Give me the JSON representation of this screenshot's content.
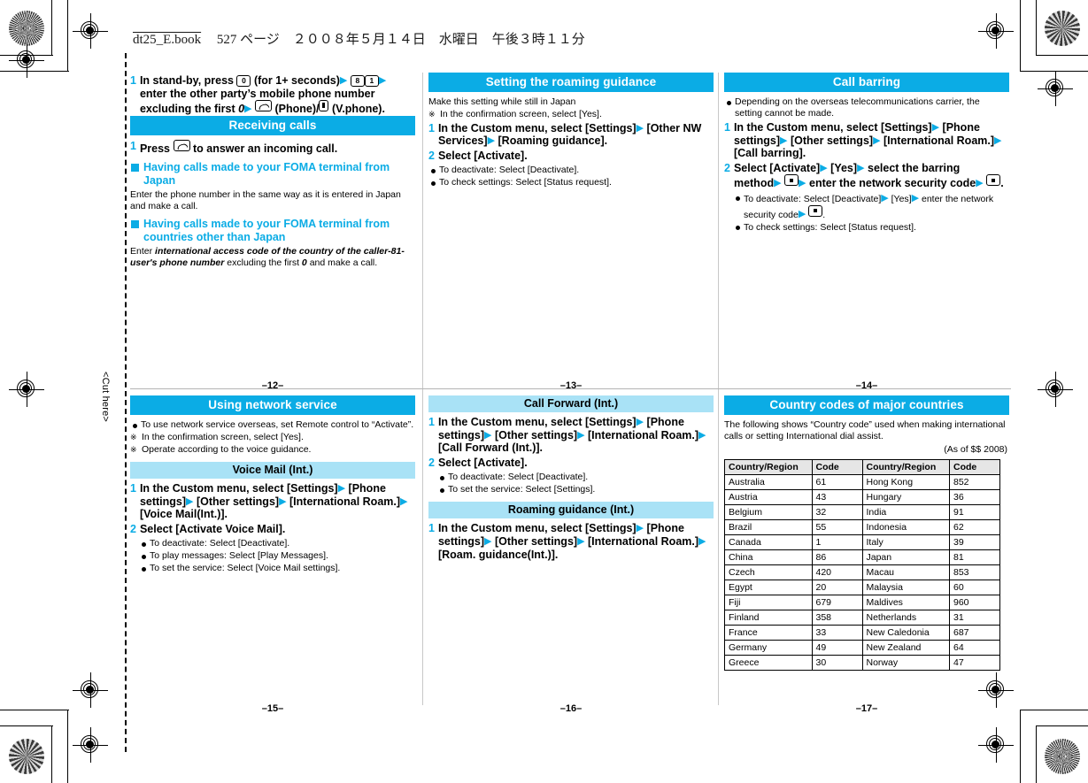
{
  "meta": {
    "book_line": "dt25_E.book",
    "book_line_rest": "527 ページ　２００８年５月１４日　水曜日　午後３時１１分",
    "cut_here": "<Cut here>",
    "accent_color": "#0BACE5",
    "subheader_color": "#A9E2F6"
  },
  "pages": {
    "p12": "–12–",
    "p13": "–13–",
    "p14": "–14–",
    "p15": "–15–",
    "p16": "–16–",
    "p17": "–17–"
  },
  "col1": {
    "step1": {
      "num": "1",
      "a": "In stand-by, press",
      "key0": "0",
      "b": "(for 1+ seconds)",
      "key8": "8",
      "key1": "1",
      "c": "enter the other party’s mobile phone number excluding the first",
      "zero": "0",
      "d": "(Phone)/",
      "e": "(V.phone)."
    },
    "receiving_header": "Receiving calls",
    "receiving_step": {
      "num": "1",
      "a": "Press",
      "b": "to answer an incoming call."
    },
    "sub1_title": "Having calls made to your FOMA terminal from Japan",
    "sub1_text": "Enter the phone number in the same way as it is entered in Japan and make a call.",
    "sub2_title": "Having calls made to your FOMA terminal from countries other than Japan",
    "sub2_pre": "Enter",
    "sub2_em": "international access code of the country of the caller-81-user's phone number",
    "sub2_mid": "excluding the first",
    "sub2_zero": "0",
    "sub2_post": "and make a call."
  },
  "col2": {
    "header": "Setting the roaming guidance",
    "lead": "Make this setting while still in Japan",
    "note": "In the confirmation screen, select [Yes].",
    "step1": {
      "num": "1",
      "a": "In the Custom menu, select [Settings]",
      "b": "[Other NW Services]",
      "c": "[Roaming guidance]."
    },
    "step2": {
      "num": "2",
      "a": "Select [Activate]."
    },
    "bullets": [
      "To deactivate: Select [Deactivate].",
      "To check settings: Select [Status request]."
    ]
  },
  "col3": {
    "header": "Call barring",
    "bullet_top": "Depending on the overseas telecommunications carrier, the setting cannot be made.",
    "step1": {
      "num": "1",
      "a": "In the Custom menu, select [Settings]",
      "b": "[Phone settings]",
      "c": "[Other settings]",
      "d": "[International Roam.]",
      "e": "[Call barring]."
    },
    "step2": {
      "num": "2",
      "a": "Select [Activate]",
      "b": "[Yes]",
      "c": "select the barring method",
      "d": "enter the network security code",
      "end": "."
    },
    "bullet1_a": "To deactivate: Select [Deactivate]",
    "bullet1_b": "[Yes]",
    "bullet1_c": "enter the network security code",
    "bullet1_end": ".",
    "bullet2": "To check settings: Select [Status request]."
  },
  "col4": {
    "header": "Using network service",
    "bullet": "To use network service overseas, set Remote control to “Activate”.",
    "note1": "In the confirmation screen, select [Yes].",
    "note2": "Operate according to the voice guidance.",
    "subheader": "Voice Mail (Int.)",
    "step1": {
      "num": "1",
      "a": "In the Custom menu, select [Settings]",
      "b": "[Phone settings]",
      "c": "[Other settings]",
      "d": "[International Roam.]",
      "e": "[Voice Mail(Int.)]."
    },
    "step2": {
      "num": "2",
      "a": "Select [Activate Voice Mail]."
    },
    "bullets": [
      "To deactivate: Select [Deactivate].",
      "To play messages: Select [Play Messages].",
      "To set the service: Select [Voice Mail settings]."
    ]
  },
  "col5": {
    "subheader1": "Call Forward (Int.)",
    "step1": {
      "num": "1",
      "a": "In the Custom menu, select [Settings]",
      "b": "[Phone settings]",
      "c": "[Other settings]",
      "d": "[International Roam.]",
      "e": "[Call Forward (Int.)]."
    },
    "step2": {
      "num": "2",
      "a": "Select [Activate]."
    },
    "bullets": [
      "To deactivate: Select [Deactivate].",
      "To set the service: Select [Settings]."
    ],
    "subheader2": "Roaming guidance (Int.)",
    "step3": {
      "num": "1",
      "a": "In the Custom menu, select [Settings]",
      "b": "[Phone settings]",
      "c": "[Other settings]",
      "d": "[International Roam.]",
      "e": "[Roam. guidance(Int.)]."
    }
  },
  "col6": {
    "header": "Country codes of major countries",
    "note": "The following shows “Country code” used when making international calls or setting International dial assist.",
    "as_of": "(As of $$ 2008)",
    "table": {
      "headers": [
        "Country/Region",
        "Code",
        "Country/Region",
        "Code"
      ],
      "rows": [
        [
          "Australia",
          "61",
          "Hong Kong",
          "852"
        ],
        [
          "Austria",
          "43",
          "Hungary",
          "36"
        ],
        [
          "Belgium",
          "32",
          "India",
          "91"
        ],
        [
          "Brazil",
          "55",
          "Indonesia",
          "62"
        ],
        [
          "Canada",
          "1",
          "Italy",
          "39"
        ],
        [
          "China",
          "86",
          "Japan",
          "81"
        ],
        [
          "Czech",
          "420",
          "Macau",
          "853"
        ],
        [
          "Egypt",
          "20",
          "Malaysia",
          "60"
        ],
        [
          "Fiji",
          "679",
          "Maldives",
          "960"
        ],
        [
          "Finland",
          "358",
          "Netherlands",
          "31"
        ],
        [
          "France",
          "33",
          "New Caledonia",
          "687"
        ],
        [
          "Germany",
          "49",
          "New Zealand",
          "64"
        ],
        [
          "Greece",
          "30",
          "Norway",
          "47"
        ]
      ]
    }
  }
}
